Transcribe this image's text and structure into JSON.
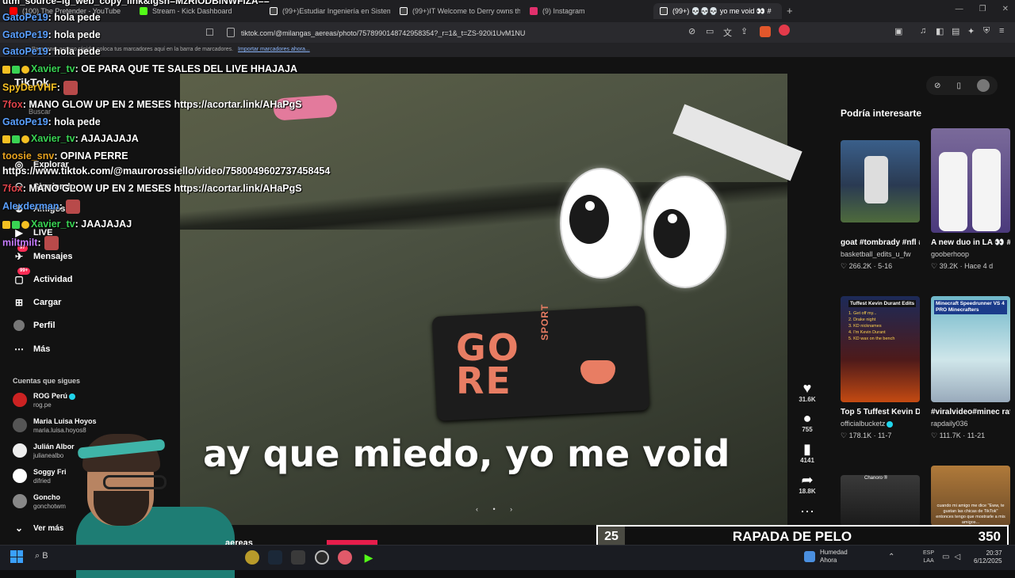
{
  "browser": {
    "tabs": [
      {
        "label": "(100) The Pretender - YouTube",
        "color": "#ff0000"
      },
      {
        "label": "Stream - Kick Dashboard",
        "color": "#53fc18"
      },
      {
        "label": "(99+)Estudiar Ingeniería en Sistemas",
        "color": "#ffffff"
      },
      {
        "label": "(99+)IT Welcome to Derry owns this",
        "color": "#ffffff"
      },
      {
        "label": "(9) Instagram",
        "color": "#e1306c"
      },
      {
        "label": "(99+) 💀💀💀 yo me void 👀 #",
        "color": "#ffffff"
      }
    ],
    "new_tab": "+",
    "url": "tiktok.com/@milangas_aereas/photo/7578990148742958354?_r=1&_t=ZS-920i1UvM1NU",
    "bookmarks_text": "Para tener acceso rápido, coloca tus marcadores aquí en la barra de marcadores.",
    "bookmarks_link": "Importar marcadores ahora...",
    "overlay_url_line": "utm_source=ig_web_copy_link&igsh=MzRlODBiNWFlZA=="
  },
  "tiktok": {
    "logo": "TikTok",
    "search_placeholder": "Buscar",
    "nav": [
      {
        "label": "Explorar",
        "icon": "compass"
      },
      {
        "label": "Siguiendo",
        "icon": "people"
      },
      {
        "label": "Amigos",
        "icon": "friends"
      },
      {
        "label": "LIVE",
        "icon": "live"
      },
      {
        "label": "Mensajes",
        "icon": "message",
        "badge": "97"
      },
      {
        "label": "Actividad",
        "icon": "activity",
        "badge": "99+"
      },
      {
        "label": "Cargar",
        "icon": "upload"
      },
      {
        "label": "Perfil",
        "icon": "profile"
      },
      {
        "label": "Más",
        "icon": "more"
      }
    ],
    "following_title": "Cuentas que sigues",
    "following": [
      {
        "name": "ROG Perú",
        "handle": "rog.pe",
        "verified": true
      },
      {
        "name": "Maria Luisa Hoyos",
        "handle": "maria.luisa.hoyos8"
      },
      {
        "name": "Julián Albor",
        "handle": "julianealbo"
      },
      {
        "name": "Soggy Fri",
        "handle": "difried"
      },
      {
        "name": "Goncho",
        "handle": "gonchotwm"
      }
    ],
    "see_more": "Ver más",
    "caption": "ay que miedo, yo me void",
    "actions": [
      {
        "icon": "heart",
        "count": "31.6K"
      },
      {
        "icon": "comment",
        "count": "755"
      },
      {
        "icon": "bookmark",
        "count": "4141"
      },
      {
        "icon": "share",
        "count": "18.8K"
      },
      {
        "icon": "more",
        "count": ""
      }
    ],
    "recommend_title": "Podría interesarte",
    "recommendations": [
      {
        "title": "goat #tombrady #nfl #edits #patriots...",
        "author": "basketball_edits_u_fw",
        "stats": "♡ 266.2K · 5-16"
      },
      {
        "title": "A new duo in LA 👀 #lukadoncic...",
        "author": "gooberhoop",
        "stats": "♡ 39.2K · Hace 4 d"
      },
      {
        "title": "Top 5 Tuffest Kevin Durant Edit...",
        "author": "officialbucketz",
        "stats": "♡ 178.1K · 11-7",
        "verified": true
      },
      {
        "title": "#viralvideo#minec raftbuilding#Min...",
        "author": "rapdaily036",
        "stats": "♡ 111.7K · 11-21"
      },
      {
        "title": "",
        "author": "",
        "stats": ""
      },
      {
        "title": "",
        "author": "",
        "stats": ""
      }
    ],
    "thumb_texts": {
      "kd_title": "Tuffest Kevin Durant Edits",
      "kd_lines": [
        "1. Get off my...",
        "2. Drake night",
        "3. KD nicknames",
        "4. I'm Kevin Durant",
        "5. KD wax on the bench"
      ],
      "mc_title": "Minecraft Speedrunner VS 4 PRO Minecrafters",
      "chanoro": "Chanoro ®",
      "person_caption": "cuando mi amigo me dice \"Eww, te gustan las chicas de TikTok\" entonces tengo que mostrarle a mis amigos..."
    }
  },
  "chat": [
    {
      "user": "GatoPe19",
      "color": "#5aa0ff",
      "msg": ": hola pede"
    },
    {
      "user": "GatoPe19",
      "color": "#5aa0ff",
      "msg": ": hola pede"
    },
    {
      "user": "GatoPe19",
      "color": "#5aa0ff",
      "msg": ": hola pede"
    },
    {
      "user": "Xavier_tv",
      "color": "#39d353",
      "msg": ": OE PARA QUE TE SALES DEL LIVE HHAJAJA",
      "badges": true
    },
    {
      "user": "SpyDerVHF",
      "color": "#f6c022",
      "msg": ":",
      "emote": true
    },
    {
      "user": "7fox",
      "color": "#e0434a",
      "msg": ": MANO GLOW UP EN 2 MESES https://acortar.link/AHaPgS"
    },
    {
      "user": "GatoPe19",
      "color": "#5aa0ff",
      "msg": ": hola pede"
    },
    {
      "user": "Xavier_tv",
      "color": "#39d353",
      "msg": ": AJAJAJAJA",
      "badges": true
    },
    {
      "user": "toosie_snv",
      "color": "#e6a11f",
      "msg": ": OPINA PERRE"
    },
    {
      "user": "",
      "color": "#ffffff",
      "msg": "https://www.tiktok.com/@maurorossiello/video/7580049602737458454"
    },
    {
      "user": "7fox",
      "color": "#e0434a",
      "msg": ": MANO GLOW UP EN 2 MESES https://acortar.link/AHaPgS"
    },
    {
      "user": "Alexderman",
      "color": "#5aa0ff",
      "msg": ":",
      "emote": true
    },
    {
      "user": "Xavier_tv",
      "color": "#39d353",
      "msg": ": JAAJAJAJ",
      "badges": true
    },
    {
      "user": "miltmilt",
      "color": "#c77dff",
      "msg": ":",
      "emote": true
    }
  ],
  "overlay": {
    "goal_left": "25",
    "goal_text": "RAPADA DE PELO",
    "goal_right": "350",
    "bottom_text": "aereas"
  },
  "taskbar": {
    "search": "B",
    "weather_title": "Humedad",
    "weather_sub": "Ahora",
    "lang_top": "ESP",
    "lang_bottom": "LAA",
    "time": "20:37",
    "date": "6/12/2025"
  }
}
